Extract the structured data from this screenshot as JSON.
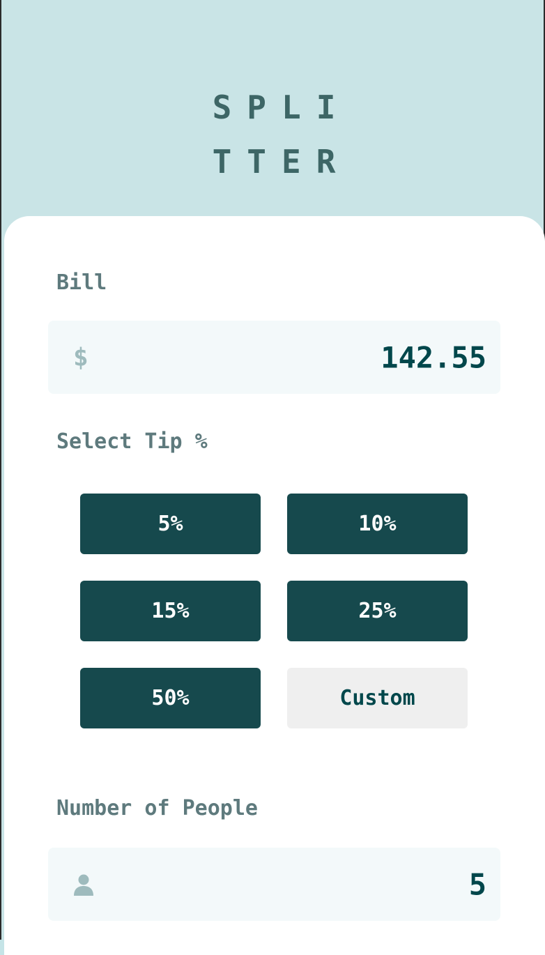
{
  "logo": {
    "line1": "SPLI",
    "line2": "TTER"
  },
  "bill": {
    "label": "Bill",
    "currency_symbol": "$",
    "value": "142.55"
  },
  "tip": {
    "label": "Select Tip %",
    "options": [
      "5%",
      "10%",
      "15%",
      "25%",
      "50%"
    ],
    "custom_label": "Custom"
  },
  "people": {
    "label": "Number of People",
    "icon": "person-icon",
    "value": "5"
  },
  "colors": {
    "background": "#c5e4e7",
    "dark_cyan": "#00474b",
    "label_gray": "#5e7a7d",
    "input_bg": "#f3f9fa",
    "custom_bg": "#efefef"
  }
}
